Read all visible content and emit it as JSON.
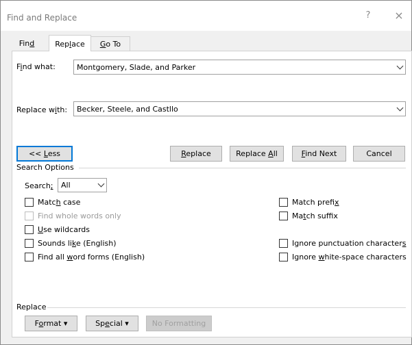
{
  "window": {
    "title": "Find and Replace",
    "help_glyph": "?",
    "close_glyph": "×"
  },
  "tabs": [
    {
      "pre": "Fin",
      "key": "d",
      "post": ""
    },
    {
      "pre": "Rep",
      "key": "l",
      "post": "ace"
    },
    {
      "pre": "",
      "key": "G",
      "post": "o To"
    }
  ],
  "find_what": {
    "label_pre": "F",
    "label_key": "i",
    "label_post": "nd what:",
    "value": "Montgomery, Slade, and Parker"
  },
  "replace_with": {
    "label_pre": "Replace w",
    "label_key": "i",
    "label_post": "th:",
    "value": "Becker, Steele, and Castllo"
  },
  "buttons": {
    "less": {
      "pre": "<< ",
      "key": "L",
      "post": "ess"
    },
    "replace": {
      "pre": "",
      "key": "R",
      "post": "eplace"
    },
    "replace_all": {
      "pre": "Replace ",
      "key": "A",
      "post": "ll"
    },
    "find_next": {
      "pre": "",
      "key": "F",
      "post": "ind Next"
    },
    "cancel": "Cancel"
  },
  "search_options": {
    "title": "Search Options",
    "search_label_pre": "Search",
    "search_label_key": ";",
    "search_label_post": "",
    "search_value": "All",
    "left": [
      {
        "pre": "Matc",
        "key": "h",
        "post": " case",
        "checked": false,
        "disabled": false
      },
      {
        "pre": "Find whole words only",
        "key": "",
        "post": "",
        "checked": false,
        "disabled": true
      },
      {
        "pre": "",
        "key": "U",
        "post": "se wildcards",
        "checked": false,
        "disabled": false
      },
      {
        "pre": "Sounds li",
        "key": "k",
        "post": "e (English)",
        "checked": false,
        "disabled": false
      },
      {
        "pre": "Find all ",
        "key": "w",
        "post": "ord forms (English)",
        "checked": false,
        "disabled": false
      }
    ],
    "right": [
      {
        "pre": "Match prefi",
        "key": "x",
        "post": "",
        "checked": false,
        "disabled": false
      },
      {
        "pre": "Ma",
        "key": "t",
        "post": "ch suffix",
        "checked": false,
        "disabled": false
      },
      {
        "pre": "Ignore punctuation character",
        "key": "s",
        "post": "",
        "checked": false,
        "disabled": false
      },
      {
        "pre": "Ignore ",
        "key": "w",
        "post": "hite-space characters",
        "checked": false,
        "disabled": false
      }
    ]
  },
  "replace_section": {
    "title": "Replace",
    "format": {
      "pre": "F",
      "key": "o",
      "post": "rmat ▾"
    },
    "special": {
      "pre": "Sp",
      "key": "e",
      "post": "cial ▾"
    },
    "no_formatting": "No Formatting"
  }
}
